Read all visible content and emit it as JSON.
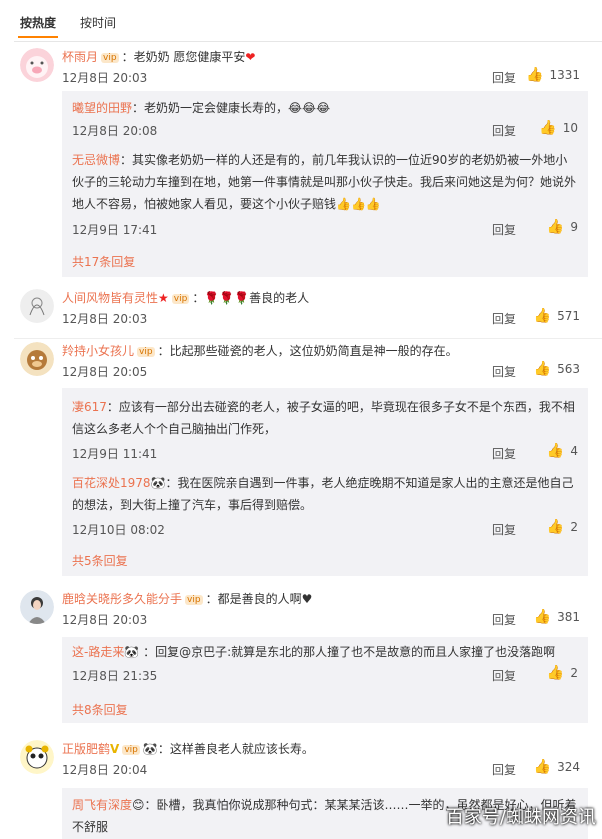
{
  "tabs": {
    "hot": "按热度",
    "time": "按时间"
  },
  "comments": [
    {
      "user": "杯雨月",
      "text": "：老奶奶 愿您健康平安",
      "time": "12月8日 20:03",
      "reply": "回复",
      "likes": "1331",
      "subs": [
        {
          "user": "曦望的田野",
          "text": "：老奶奶一定会健康长寿的，",
          "time": "12月8日 20:08",
          "reply": "回复",
          "likes": "10"
        },
        {
          "user": "无忌微博",
          "text": "：其实像老奶奶一样的人还是有的，前几年我认识的一位近90岁的老奶奶被一外地小伙子的三轮动力车撞到在地，她第一件事情就是叫那小伙子快走。我后来问她这是为何？她说外地人不容易，怕被她家人看见，要这个小伙子赔钱",
          "time": "12月9日 17:41",
          "reply": "回复",
          "likes": "9"
        }
      ],
      "more": "共17条回复"
    },
    {
      "user": "人间风物皆有灵性",
      "text": "：🌹🌹🌹善良的老人",
      "time": "12月8日 20:03",
      "reply": "回复",
      "likes": "571"
    },
    {
      "user": "羚持小女孩儿",
      "text": "：比起那些碰瓷的老人，这位奶奶简直是神一般的存在。",
      "time": "12月8日 20:05",
      "reply": "回复",
      "likes": "563",
      "subs": [
        {
          "user": "凄617",
          "text": "：应该有一部分出去碰瓷的老人，被子女逼的吧，毕竟现在很多子女不是个东西，我不相信这么多老人个个自己脑抽出门作死，",
          "time": "12月9日 11:41",
          "reply": "回复",
          "likes": "4"
        },
        {
          "user": "百花深处1978",
          "text": "：我在医院亲自遇到一件事，老人绝症晚期不知道是家人出的主意还是他自己的想法，到大街上撞了汽车，事后得到赔偿。",
          "time": "12月10日 08:02",
          "reply": "回复",
          "likes": "2"
        }
      ],
      "more": "共5条回复"
    },
    {
      "user": "鹿晗关晓彤多久能分手",
      "text": "：都是善良的人啊♥",
      "time": "12月8日 20:03",
      "reply": "回复",
      "likes": "381",
      "subs": [
        {
          "user": "这-路走来",
          "text": " ：回复@京巴子:就算是东北的那人撞了也不是故意的而且人家撞了也没落跑啊",
          "time": "12月8日 21:35",
          "reply": "回复",
          "likes": "2"
        }
      ],
      "more": "共8条回复"
    },
    {
      "user": "正版肥鹤",
      "text": "：这样善良老人就应该长寿。",
      "time": "12月8日 20:04",
      "reply": "回复",
      "likes": "324",
      "subs": [
        {
          "user": "周飞有深度",
          "text": "：卧槽，我真怕你说成那种句式：某某某活该……一举的，虽然都是好心，但听着不舒服",
          "time": "",
          "reply": "",
          "likes": ""
        }
      ]
    }
  ],
  "watermark": "百家号/蜘蛛网资讯",
  "colors": {
    "username": "#eb7350",
    "sub_bg": "#f2f2f5",
    "tab_underline": "#ff8200"
  }
}
